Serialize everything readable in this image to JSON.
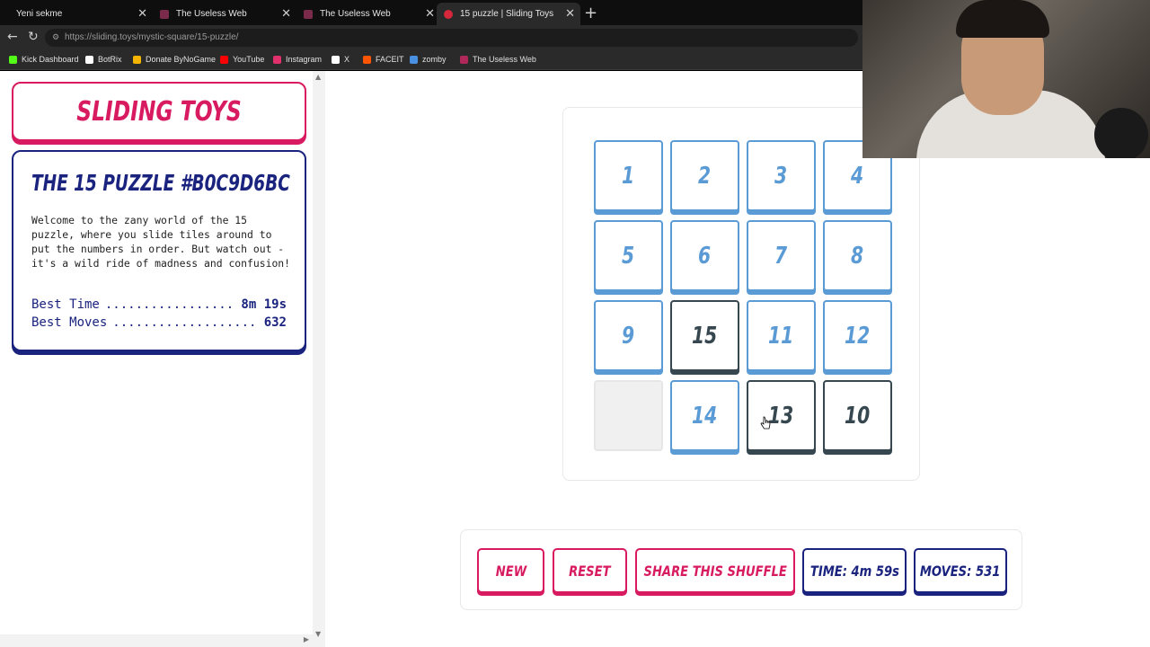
{
  "browser": {
    "tabs": [
      {
        "title": "Yeni sekme"
      },
      {
        "title": "The Useless Web"
      },
      {
        "title": "The Useless Web"
      },
      {
        "title": "15 puzzle | Sliding Toys"
      }
    ],
    "url": "https://sliding.toys/mystic-square/15-puzzle/",
    "bookmarks": [
      {
        "label": "Kick Dashboard",
        "color": "#53fc18"
      },
      {
        "label": "BotRix",
        "color": "#ffffff"
      },
      {
        "label": "Donate ByNoGame",
        "color": "#f5b400"
      },
      {
        "label": "YouTube",
        "color": "#ff0000"
      },
      {
        "label": "Instagram",
        "color": "#e1306c"
      },
      {
        "label": "X",
        "color": "#ffffff"
      },
      {
        "label": "FACEIT",
        "color": "#ff5500"
      },
      {
        "label": "zomby",
        "color": "#4a90e2"
      },
      {
        "label": "The Useless Web",
        "color": "#b0275a"
      }
    ]
  },
  "sidebar": {
    "brand": "SLIDING TOYS",
    "title": "THE 15 PUZZLE #B0C9D6BC",
    "description": "Welcome to the zany world of the 15 puzzle, where you slide tiles around to put the numbers in order. But watch out - it's a wild ride of madness and confusion!",
    "best_time_label": "Best Time",
    "best_time_value": "8m 19s",
    "best_moves_label": "Best Moves",
    "best_moves_value": "632"
  },
  "puzzle": {
    "tiles": [
      {
        "n": "1",
        "state": "correct"
      },
      {
        "n": "2",
        "state": "correct"
      },
      {
        "n": "3",
        "state": "correct"
      },
      {
        "n": "4",
        "state": "correct"
      },
      {
        "n": "5",
        "state": "correct"
      },
      {
        "n": "6",
        "state": "correct"
      },
      {
        "n": "7",
        "state": "correct"
      },
      {
        "n": "8",
        "state": "correct"
      },
      {
        "n": "9",
        "state": "correct"
      },
      {
        "n": "15",
        "state": "wrong"
      },
      {
        "n": "11",
        "state": "correct"
      },
      {
        "n": "12",
        "state": "correct"
      },
      {
        "n": "",
        "state": "empty"
      },
      {
        "n": "14",
        "state": "correct"
      },
      {
        "n": "13",
        "state": "wrong"
      },
      {
        "n": "10",
        "state": "wrong"
      }
    ]
  },
  "controls": {
    "new_label": "NEW",
    "reset_label": "RESET",
    "share_label": "SHARE THIS SHUFFLE",
    "time_label": "TIME: 4m 59s",
    "moves_label": "MOVES: 531"
  },
  "colors": {
    "accent_pink": "#d81b60",
    "navy": "#1a237e",
    "tile_blue": "#5b9bd5",
    "tile_dark": "#37474f"
  }
}
